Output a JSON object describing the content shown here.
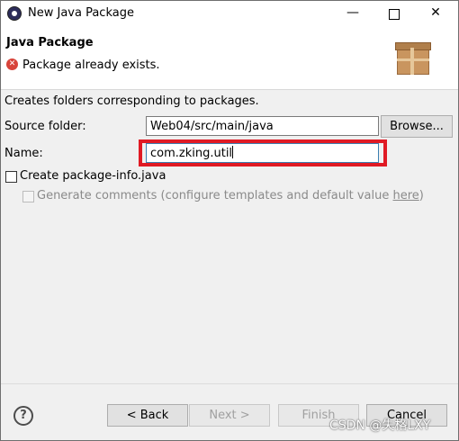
{
  "window": {
    "title": "New Java Package",
    "minimize": "—",
    "close": "✕"
  },
  "header": {
    "title": "Java Package",
    "error_icon": "error-icon",
    "error_message": "Package already exists.",
    "banner_icon": "package-gift-icon"
  },
  "form": {
    "description": "Creates folders corresponding to packages.",
    "source_folder_label": "Source folder:",
    "source_folder_value": "Web04/src/main/java",
    "browse_label": "Browse...",
    "name_label": "Name:",
    "name_value": "com.zking.util",
    "create_package_info_label": "Create package-info.java",
    "create_package_info_checked": false,
    "generate_comments_label": "Generate comments (configure templates and default value ",
    "generate_comments_link": "here",
    "generate_comments_suffix": ")",
    "generate_comments_checked": false
  },
  "footer": {
    "help": "?",
    "back_label": "< Back",
    "next_label": "Next >",
    "finish_label": "Finish",
    "cancel_label": "Cancel"
  },
  "watermark": "CSDN @失格LXY",
  "colors": {
    "highlight": "#e01a24",
    "error": "#d8443a"
  }
}
